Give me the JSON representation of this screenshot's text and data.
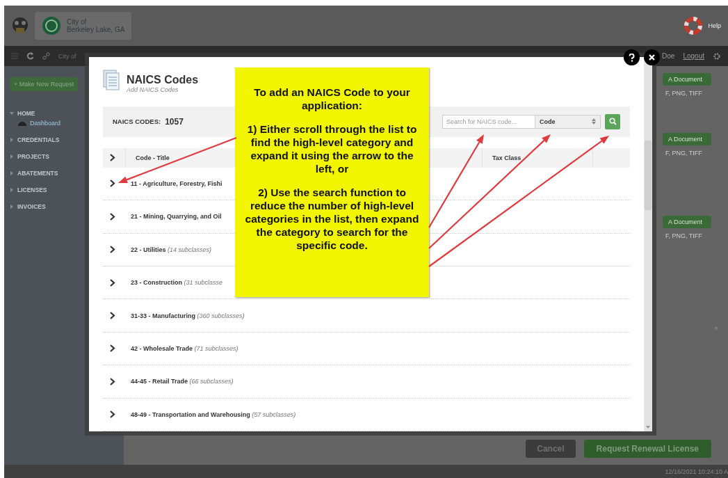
{
  "header": {
    "org_line1": "City of",
    "org_line2": "Berkeley Lake, GA",
    "help": "Help"
  },
  "navbar": {
    "breadcrumb": "City of",
    "user": "Doe",
    "logout": "Logout"
  },
  "sidebar": {
    "new_request": "+ Make New Request",
    "items": [
      {
        "label": "HOME",
        "expanded": true,
        "children": [
          {
            "label": "Dashboard"
          }
        ]
      },
      {
        "label": "CREDENTIALS",
        "expanded": false
      },
      {
        "label": "PROJECTS",
        "expanded": false
      },
      {
        "label": "ABATEMENTS",
        "expanded": false
      },
      {
        "label": "LICENSES",
        "expanded": false
      },
      {
        "label": "INVOICES",
        "expanded": false
      }
    ]
  },
  "background": {
    "documents": [
      {
        "button": "A Document",
        "types": "F, PNG, TIFF"
      },
      {
        "button": "A Document",
        "types": "F, PNG, TIFF"
      },
      {
        "button": "A Document",
        "types": "F, PNG, TIFF"
      }
    ],
    "required_mark": "*",
    "cancel": "Cancel",
    "submit": "Request Renewal License"
  },
  "modal": {
    "title": "NAICS Codes",
    "subtitle": "Add NAICS Codes",
    "count_label": "NAICS CODES:",
    "count": "1057",
    "search": {
      "placeholder": "Search for NAICS code..."
    },
    "filter": "Code",
    "columns": [
      "Code - Title",
      "Tax Class"
    ],
    "rows": [
      {
        "label": "11 - Agriculture, Forestry, Fishi",
        "expanded": false
      },
      {
        "label": "21 - Mining, Quarrying, and Oil",
        "expanded": false
      },
      {
        "label": "22 - Utilities",
        "subclasses": "(14 subclasses)",
        "expanded": false
      },
      {
        "label": "23 - Construction",
        "subclasses": "(31 subclasse",
        "expanded": false
      },
      {
        "label": "31-33 - Manufacturing",
        "subclasses": "(360 subclasses)",
        "expanded": false
      },
      {
        "label": "42 - Wholesale Trade",
        "subclasses": "(71 subclasses)",
        "expanded": false
      },
      {
        "label": "44-45 - Retail Trade",
        "subclasses": "(66 subclasses)",
        "expanded": false
      },
      {
        "label": "48-49 - Transportation and Warehousing",
        "subclasses": "(57 subclasses)",
        "expanded": false
      }
    ]
  },
  "callout": {
    "paragraphs": [
      "To add an NAICS Code to your application:",
      "1) Either scroll through the list to find the high-level category and expand it using the arrow to the left, or",
      "2) Use the search function to reduce the number of high-level categories in the list, then expand the category to search for the specific code."
    ]
  },
  "footer": {
    "timestamp": "12/16/2021 10:24:10 A"
  }
}
